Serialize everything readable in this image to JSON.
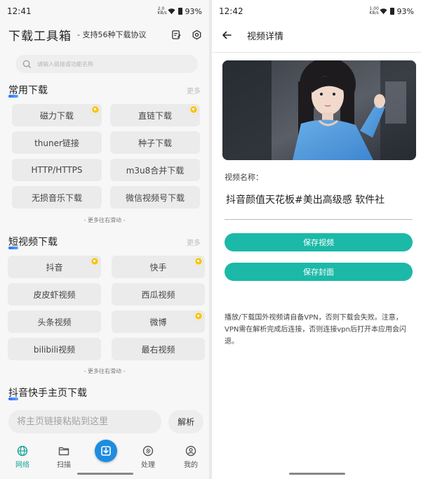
{
  "left": {
    "status": {
      "time": "12:41",
      "net": "2.0 KB/s",
      "battery": "93%"
    },
    "title": "下载工具箱",
    "subtitle": "- 支持56种下载协议",
    "search_placeholder": "请输入链接或功能名称",
    "section1": {
      "title": "常用下载",
      "more": "更多",
      "items": [
        {
          "label": "磁力下载",
          "badge": false
        },
        {
          "label": "直链下载",
          "badge": true
        },
        {
          "label": "thuner链接",
          "badge": false
        },
        {
          "label": "种子下载",
          "badge": false
        },
        {
          "label": "HTTP/HTTPS",
          "badge": false
        },
        {
          "label": "m3u8合并下载",
          "badge": false
        },
        {
          "label": "无损音乐下载",
          "badge": false
        },
        {
          "label": "微信视频号下载",
          "badge": false
        }
      ],
      "hint": "- 更多往右滑动 -"
    },
    "section2": {
      "title": "短视频下载",
      "more": "更多",
      "items": [
        {
          "label": "抖音",
          "badge": true
        },
        {
          "label": "快手",
          "badge": true
        },
        {
          "label": "皮皮虾视频",
          "badge": false
        },
        {
          "label": "西瓜视频",
          "badge": false
        },
        {
          "label": "头条视频",
          "badge": false
        },
        {
          "label": "微博",
          "badge": true
        },
        {
          "label": "bilibili视频",
          "badge": false
        },
        {
          "label": "最右视频",
          "badge": false
        }
      ],
      "hint": "- 更多往右滑动 -"
    },
    "section3": {
      "title": "抖音快手主页下载"
    },
    "paste_placeholder": "将主页链接粘贴到这里",
    "parse_label": "解析",
    "nav": [
      {
        "label": "网络",
        "icon": "globe-icon",
        "active": true
      },
      {
        "label": "扫描",
        "icon": "folder-icon",
        "active": false
      },
      {
        "label": "",
        "icon": "download-icon",
        "active": false
      },
      {
        "label": "处理",
        "icon": "process-icon",
        "active": false
      },
      {
        "label": "我的",
        "icon": "user-icon",
        "active": false
      }
    ],
    "accent": "#17a398"
  },
  "right": {
    "status": {
      "time": "12:42",
      "net": "1.00 KB/s",
      "battery": "93%"
    },
    "title": "视频详情",
    "field_label": "视频名称：",
    "field_value": "抖音颜值天花板#美出高级感 软件社",
    "save_video": "保存视频",
    "save_cover": "保存封面",
    "notice": "播放/下载国外视频请自备VPN，否则下载会失败。注意，VPN需在解析完成后连接，否则连接vpn后打开本应用会闪退。",
    "button_color": "#1cb9a8"
  }
}
